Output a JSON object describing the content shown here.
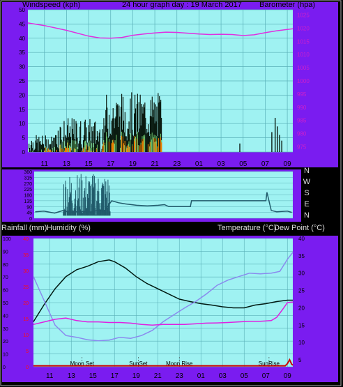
{
  "colors": {
    "background": "#7a1cf0",
    "plot_bg": "#9ff2f2",
    "grid": "#5ab0b8",
    "wind_gust": "#0a1a10",
    "wind_avg": "#7de07a",
    "wind_speed": "#f08000",
    "barometer": "#e030e0",
    "wind_dir": "#205a6a",
    "temperature": "#001a12",
    "dew_point": "#8a8aee",
    "humidity": "#e020e0",
    "rainfall": "#cc0000",
    "left_axis_text": "#ff1010",
    "right_axis_text": "#cc20cc"
  },
  "header": {
    "left": "Windspeed (kph)",
    "center": "24 hour graph day : 19 March 2017",
    "right": "Barometer (hpa)"
  },
  "lower_header": {
    "left1": "Rainfall (mm)",
    "left2": "Humidity (%)",
    "right": "Temperature (°C)",
    "right2": "Dew Point (°C)"
  },
  "chart_data": [
    {
      "type": "line",
      "id": "wind_baro",
      "x_ticks": [
        "11",
        "13",
        "15",
        "17",
        "19",
        "21",
        "23",
        "01",
        "03",
        "05",
        "07",
        "09"
      ],
      "left_ticks": [
        0,
        5,
        10,
        15,
        20,
        25,
        30,
        35,
        40,
        45,
        50
      ],
      "right_ticks": [
        975,
        980,
        985,
        990,
        995,
        1000,
        1005,
        1010,
        1015,
        1020,
        1025
      ],
      "ylim_left": [
        0,
        50
      ],
      "ylim_right": [
        973,
        1027
      ],
      "series": [
        {
          "key": "barometer",
          "x": [
            9.5,
            11,
            13,
            15,
            16,
            17,
            18,
            19,
            20,
            21,
            22,
            23,
            24,
            25,
            26,
            27,
            28,
            29,
            30,
            31,
            32,
            33.5
          ],
          "values": [
            1022,
            1021,
            1019.2,
            1017,
            1016.3,
            1016.2,
            1016.5,
            1017.3,
            1017.8,
            1018.2,
            1018.5,
            1018.4,
            1018.1,
            1017.8,
            1017.6,
            1017.7,
            1017.6,
            1017.2,
            1017.5,
            1018.3,
            1019,
            1019.8
          ]
        }
      ]
    },
    {
      "type": "line",
      "id": "wind_direction",
      "right_labels": [
        "N",
        "W",
        "S",
        "E",
        "N"
      ],
      "left_ticks": [
        0,
        45,
        90,
        135,
        180,
        225,
        270,
        315,
        360
      ],
      "series": [
        {
          "key": "direction",
          "x": [
            9.6,
            10.4,
            11.4,
            12.2,
            12.8,
            13.4,
            14.2,
            14.8,
            15.4,
            16,
            16.7,
            17.3,
            18,
            19,
            20,
            21,
            21.6,
            22,
            24,
            24.1,
            28,
            30,
            31,
            31.1,
            31.5,
            32,
            33,
            33.4
          ],
          "values": [
            50,
            55,
            40,
            60,
            45,
            50,
            52,
            48,
            60,
            55,
            135,
            120,
            110,
            100,
            95,
            100,
            105,
            90,
            90,
            135,
            135,
            135,
            135,
            200,
            60,
            50,
            55,
            45
          ]
        }
      ]
    },
    {
      "type": "line",
      "id": "temp_hum",
      "left_ticks": [
        0,
        10,
        20,
        30,
        40,
        50,
        60,
        70,
        80,
        90,
        100
      ],
      "rain_ticks": [
        0,
        5,
        10,
        15,
        20,
        25,
        30,
        35,
        40
      ],
      "right_ticks": [
        5,
        10,
        15,
        20,
        25,
        30,
        35,
        40
      ],
      "x_ticks": [
        "11",
        "13",
        "15",
        "17",
        "19",
        "21",
        "23",
        "01",
        "03",
        "05",
        "07",
        "09"
      ],
      "annotations": [
        {
          "label": "Moon Set",
          "x": 14
        },
        {
          "label": "SunSet",
          "x": 19.2
        },
        {
          "label": "Moon Rise",
          "x": 23
        },
        {
          "label": "SunRise",
          "x": 31.3
        }
      ],
      "series": [
        {
          "key": "temperature",
          "x": [
            9.5,
            10.5,
            11.5,
            12.5,
            13.5,
            14.5,
            15.5,
            16.5,
            17,
            18,
            19,
            20,
            21,
            22,
            23,
            24,
            25,
            26,
            27,
            28,
            29,
            30,
            31,
            32,
            33,
            33.5
          ],
          "values": [
            16,
            21,
            25.5,
            29,
            31,
            32,
            33.3,
            33.8,
            33.3,
            31.5,
            29,
            27,
            25.5,
            24,
            22.5,
            21.8,
            21.2,
            20.8,
            20.3,
            20,
            20,
            20.8,
            21.2,
            21.8,
            22.2,
            22.2
          ]
        },
        {
          "key": "dew_point",
          "x": [
            9.5,
            10.5,
            11.5,
            12.5,
            13.5,
            14.5,
            15.5,
            16.5,
            17.5,
            18.5,
            19.5,
            20.5,
            21.5,
            22.5,
            23.5,
            24.5,
            25.5,
            26.5,
            27.5,
            28.5,
            29.5,
            30.5,
            31.5,
            32.3,
            33,
            33.5
          ],
          "values": [
            29,
            22,
            15,
            12,
            11.5,
            10.8,
            10.5,
            10.7,
            11.5,
            11.2,
            12,
            13.5,
            16,
            18,
            20,
            21.8,
            24,
            26.5,
            28,
            29,
            30,
            29.8,
            30,
            30.5,
            34,
            36
          ]
        },
        {
          "key": "humidity",
          "x": [
            9.5,
            10.5,
            11.5,
            12.5,
            13.5,
            14.5,
            15.5,
            16.5,
            17.5,
            18.5,
            19.5,
            20.5,
            21.5,
            22.5,
            23.5,
            24.5,
            25.5,
            26.5,
            27.5,
            28.5,
            29.5,
            30.5,
            31.5,
            32,
            32.5,
            33,
            33.5
          ],
          "values": [
            33,
            35,
            37,
            38,
            36,
            35,
            35,
            34.5,
            34.5,
            34,
            33,
            32.5,
            33,
            33,
            33,
            33.5,
            34,
            34.2,
            34.5,
            35,
            35.5,
            35.5,
            36,
            38.5,
            44,
            50,
            50.5
          ]
        },
        {
          "key": "rainfall",
          "x": [
            9.5,
            32.8,
            33,
            33.2,
            33.4,
            33.5
          ],
          "values": [
            0.3,
            0.3,
            1,
            2.2,
            0.8,
            0.5
          ]
        }
      ]
    }
  ]
}
